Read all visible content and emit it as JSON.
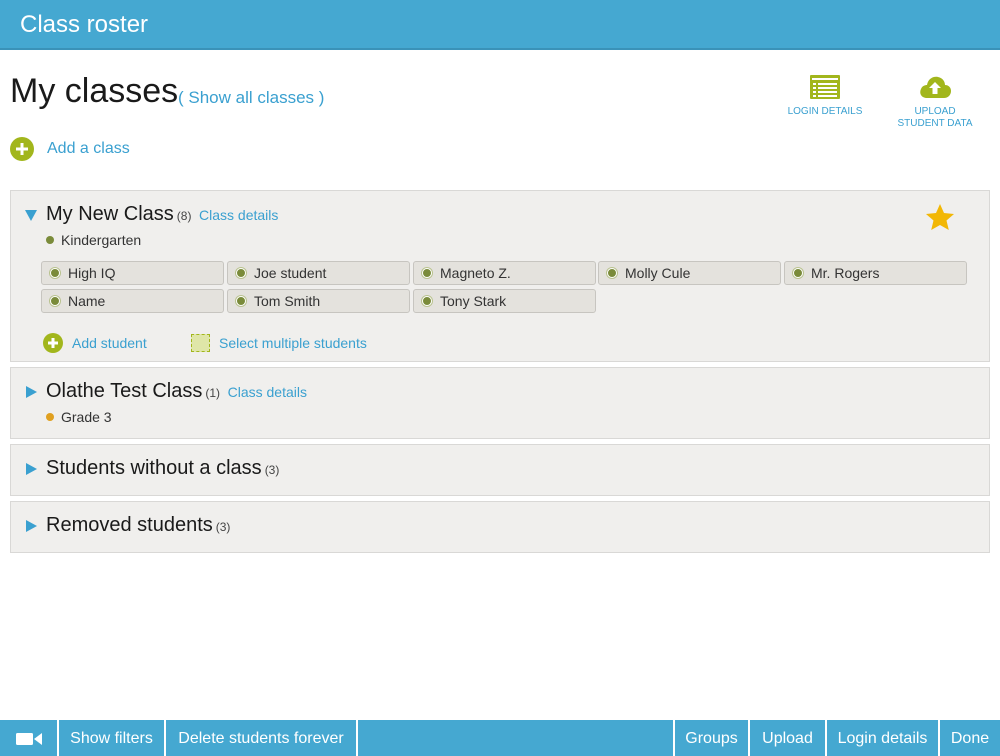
{
  "app": {
    "title": "Class roster"
  },
  "header": {
    "title": "My classes",
    "show_all": "( Show all classes )",
    "add_class": "Add a class"
  },
  "tools": {
    "login_details": "LOGIN DETAILS",
    "upload_student_data": "UPLOAD STUDENT DATA"
  },
  "classes": [
    {
      "name": "My New Class",
      "count": "(8)",
      "details_link": "Class details",
      "grade": "Kindergarten",
      "grade_color": "#7a8b3a",
      "expanded": true,
      "favorite": true,
      "students": [
        "High IQ",
        "Joe student",
        "Magneto Z.",
        "Molly Cule",
        "Mr. Rogers",
        "Name",
        "Tom Smith",
        "Tony Stark"
      ],
      "add_student": "Add student",
      "select_multiple": "Select multiple students"
    },
    {
      "name": "Olathe Test Class",
      "count": "(1)",
      "details_link": "Class details",
      "grade": "Grade 3",
      "grade_color": "#e0a020",
      "expanded": false
    }
  ],
  "groups": [
    {
      "name": "Students without a class",
      "count": "(3)"
    },
    {
      "name": "Removed students",
      "count": "(3)"
    }
  ],
  "bottom_bar": {
    "video_icon": "video-camera-icon",
    "show_filters": "Show filters",
    "delete_forever": "Delete students forever",
    "groups": "Groups",
    "upload": "Upload",
    "login_details": "Login details",
    "done": "Done"
  },
  "colors": {
    "brand": "#45a8d1",
    "link": "#3aa0d0",
    "accent_green": "#a2b61c",
    "star": "#f2b705",
    "panel_bg": "#f0efed"
  }
}
